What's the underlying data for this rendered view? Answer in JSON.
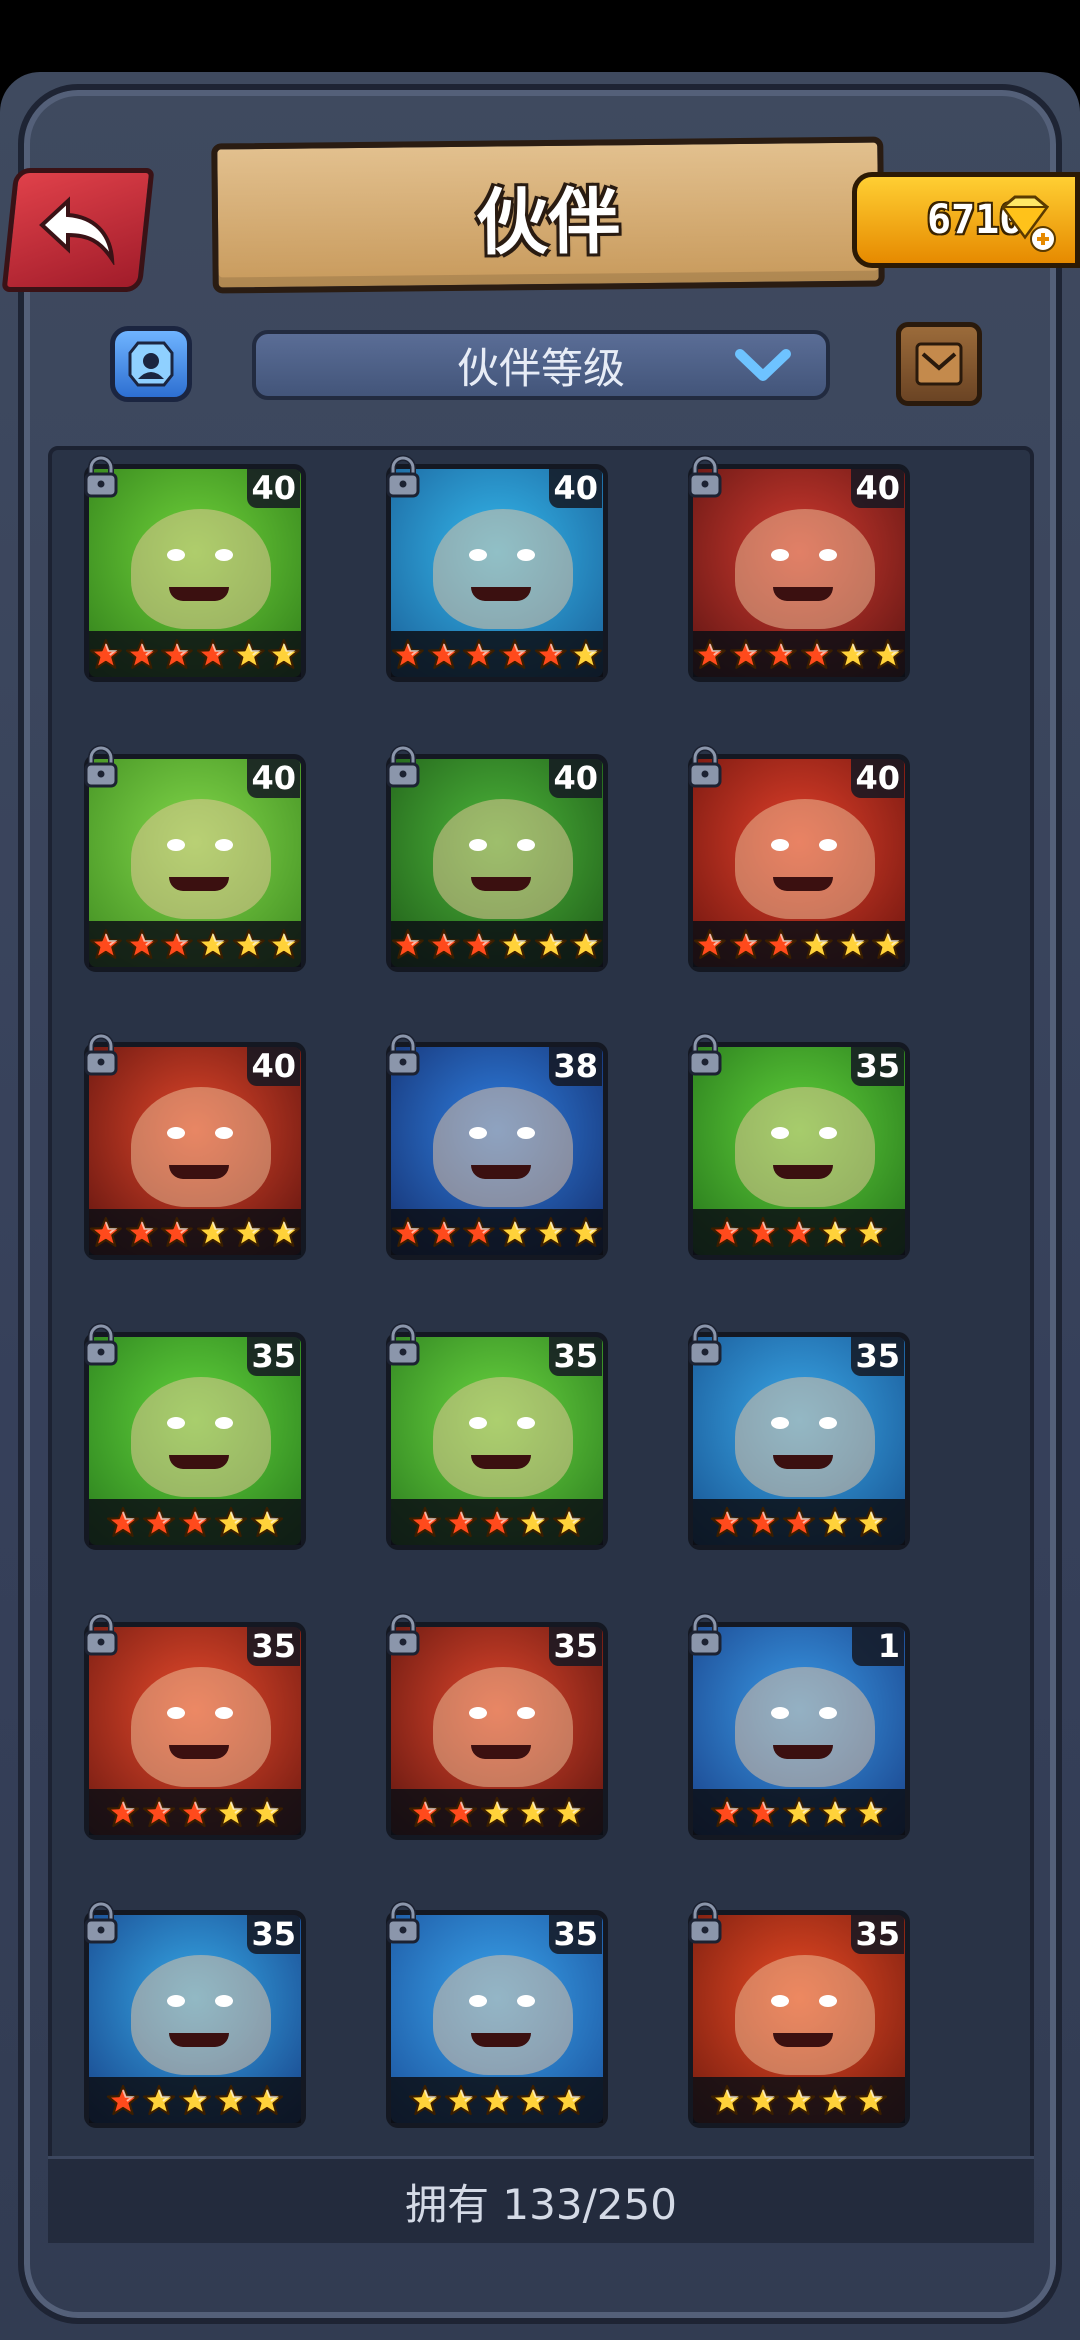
{
  "header": {
    "title": "伙伴",
    "gems": "6710"
  },
  "filter": {
    "dropdown_label": "伙伴等级"
  },
  "heroes": [
    {
      "level": "40",
      "stars_red": 4,
      "stars_gold": 2,
      "palette": [
        "#6fd23a",
        "#2f7c1a"
      ]
    },
    {
      "level": "40",
      "stars_red": 5,
      "stars_gold": 1,
      "palette": [
        "#34b8ec",
        "#1a5d96"
      ]
    },
    {
      "level": "40",
      "stars_red": 4,
      "stars_gold": 2,
      "palette": [
        "#d23a2f",
        "#5a1412"
      ]
    },
    {
      "level": "40",
      "stars_red": 3,
      "stars_gold": 3,
      "palette": [
        "#82d84a",
        "#3e8a20"
      ]
    },
    {
      "level": "40",
      "stars_red": 3,
      "stars_gold": 3,
      "palette": [
        "#4db63a",
        "#1e5a18"
      ]
    },
    {
      "level": "40",
      "stars_red": 3,
      "stars_gold": 3,
      "palette": [
        "#e2402a",
        "#6a140e"
      ]
    },
    {
      "level": "40",
      "stars_red": 3,
      "stars_gold": 3,
      "palette": [
        "#e0462a",
        "#5a120e"
      ]
    },
    {
      "level": "38",
      "stars_red": 3,
      "stars_gold": 3,
      "palette": [
        "#2f7fe0",
        "#142c6a"
      ]
    },
    {
      "level": "35",
      "stars_red": 3,
      "stars_gold": 2,
      "palette": [
        "#5fd03a",
        "#24721a"
      ]
    },
    {
      "level": "35",
      "stars_red": 3,
      "stars_gold": 2,
      "palette": [
        "#62d43c",
        "#287a1c"
      ]
    },
    {
      "level": "35",
      "stars_red": 3,
      "stars_gold": 2,
      "palette": [
        "#6ad640",
        "#2a7a1e"
      ]
    },
    {
      "level": "35",
      "stars_red": 3,
      "stars_gold": 2,
      "palette": [
        "#3aa8e8",
        "#16508e"
      ]
    },
    {
      "level": "35",
      "stars_red": 3,
      "stars_gold": 2,
      "palette": [
        "#e84a2c",
        "#6a1810"
      ]
    },
    {
      "level": "35",
      "stars_red": 2,
      "stars_gold": 3,
      "palette": [
        "#e0462c",
        "#5a140e"
      ]
    },
    {
      "level": "1",
      "stars_red": 2,
      "stars_gold": 3,
      "palette": [
        "#3a9ae6",
        "#183e86"
      ]
    },
    {
      "level": "35",
      "stars_red": 1,
      "stars_gold": 4,
      "palette": [
        "#36aae8",
        "#173f86"
      ]
    },
    {
      "level": "35",
      "stars_red": 0,
      "stars_gold": 5,
      "palette": [
        "#3aa4ec",
        "#1a4f9a"
      ]
    },
    {
      "level": "35",
      "stars_red": 0,
      "stars_gold": 5,
      "palette": [
        "#ea4a24",
        "#6e1a0e"
      ]
    }
  ],
  "footer": {
    "owned": "拥有 133/250"
  },
  "colors": {
    "star_red": "#ff4a1c",
    "star_gold": "#ffd23a"
  }
}
